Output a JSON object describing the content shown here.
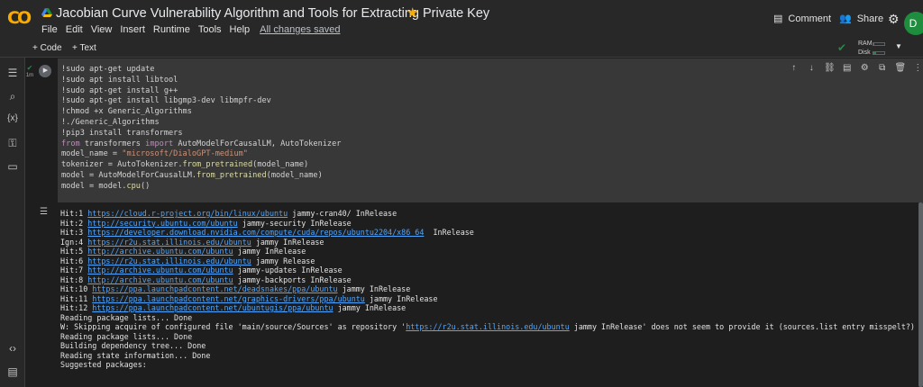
{
  "header": {
    "logo_text": "CO",
    "title": "Jacobian Curve Vulnerability Algorithm and Tools for Extracting Private Key",
    "star_icon": "star-icon",
    "menu": [
      "File",
      "Edit",
      "View",
      "Insert",
      "Runtime",
      "Tools",
      "Help"
    ],
    "saved_status": "All changes saved",
    "comment_label": "Comment",
    "share_label": "Share",
    "avatar_letter": "D"
  },
  "toolbar": {
    "add_code": "+ Code",
    "add_text": "+ Text",
    "ram_label": "RAM",
    "disk_label": "Disk",
    "ram_usage_fraction": 0.12,
    "disk_usage_fraction": 0.25
  },
  "colors": {
    "accent_orange": "#f9ab00",
    "status_green": "#1e8e3e",
    "link_blue": "#4fa6ff",
    "code_bg": "#383838"
  },
  "cell": {
    "status_icon": "check-icon",
    "exec_time": "1m",
    "code_lines": [
      "!sudo apt-get update",
      "!sudo apt install libtool",
      "!sudo apt-get install g++",
      "!sudo apt-get install libgmp3-dev libmpfr-dev",
      "!chmod +x Generic_Algorithms",
      "!./Generic_Algorithms",
      "!pip3 install transformers",
      "from transformers import AutoModelForCausalLM, AutoTokenizer",
      "model_name = \"microsoft/DialoGPT-medium\"",
      "tokenizer = AutoTokenizer.from_pretrained(model_name)",
      "model = AutoModelForCausalLM.from_pretrained(model_name)",
      "model = model.cpu()"
    ]
  },
  "output": {
    "lines": [
      {
        "prefix": "Hit:1 ",
        "link": "https://cloud.r-project.org/bin/linux/ubuntu",
        "suffix": " jammy-cran40/ InRelease"
      },
      {
        "prefix": "Hit:2 ",
        "link": "http://security.ubuntu.com/ubuntu",
        "suffix": " jammy-security InRelease"
      },
      {
        "prefix": "Hit:3 ",
        "link": "https://developer.download.nvidia.com/compute/cuda/repos/ubuntu2204/x86_64",
        "suffix": "  InRelease"
      },
      {
        "prefix": "Ign:4 ",
        "link": "https://r2u.stat.illinois.edu/ubuntu",
        "suffix": " jammy InRelease"
      },
      {
        "prefix": "Hit:5 ",
        "link": "http://archive.ubuntu.com/ubuntu",
        "suffix": " jammy InRelease"
      },
      {
        "prefix": "Hit:6 ",
        "link": "https://r2u.stat.illinois.edu/ubuntu",
        "suffix": " jammy Release"
      },
      {
        "prefix": "Hit:7 ",
        "link": "http://archive.ubuntu.com/ubuntu",
        "suffix": " jammy-updates InRelease"
      },
      {
        "prefix": "Hit:8 ",
        "link": "http://archive.ubuntu.com/ubuntu",
        "suffix": " jammy-backports InRelease"
      },
      {
        "prefix": "Hit:10 ",
        "link": "https://ppa.launchpadcontent.net/deadsnakes/ppa/ubuntu",
        "suffix": " jammy InRelease"
      },
      {
        "prefix": "Hit:11 ",
        "link": "https://ppa.launchpadcontent.net/graphics-drivers/ppa/ubuntu",
        "suffix": " jammy InRelease"
      },
      {
        "prefix": "Hit:12 ",
        "link": "https://ppa.launchpadcontent.net/ubuntugis/ppa/ubuntu",
        "suffix": " jammy InRelease"
      },
      {
        "prefix": "Reading package lists... Done",
        "link": "",
        "suffix": ""
      },
      {
        "prefix": "W: Skipping acquire of configured file 'main/source/Sources' as repository '",
        "link": "https://r2u.stat.illinois.edu/ubuntu",
        "suffix": " jammy InRelease' does not seem to provide it (sources.list entry misspelt?)"
      },
      {
        "prefix": "Reading package lists... Done",
        "link": "",
        "suffix": ""
      },
      {
        "prefix": "Building dependency tree... Done",
        "link": "",
        "suffix": ""
      },
      {
        "prefix": "Reading state information... Done",
        "link": "",
        "suffix": ""
      },
      {
        "prefix": "Suggested packages:",
        "link": "",
        "suffix": ""
      }
    ]
  }
}
